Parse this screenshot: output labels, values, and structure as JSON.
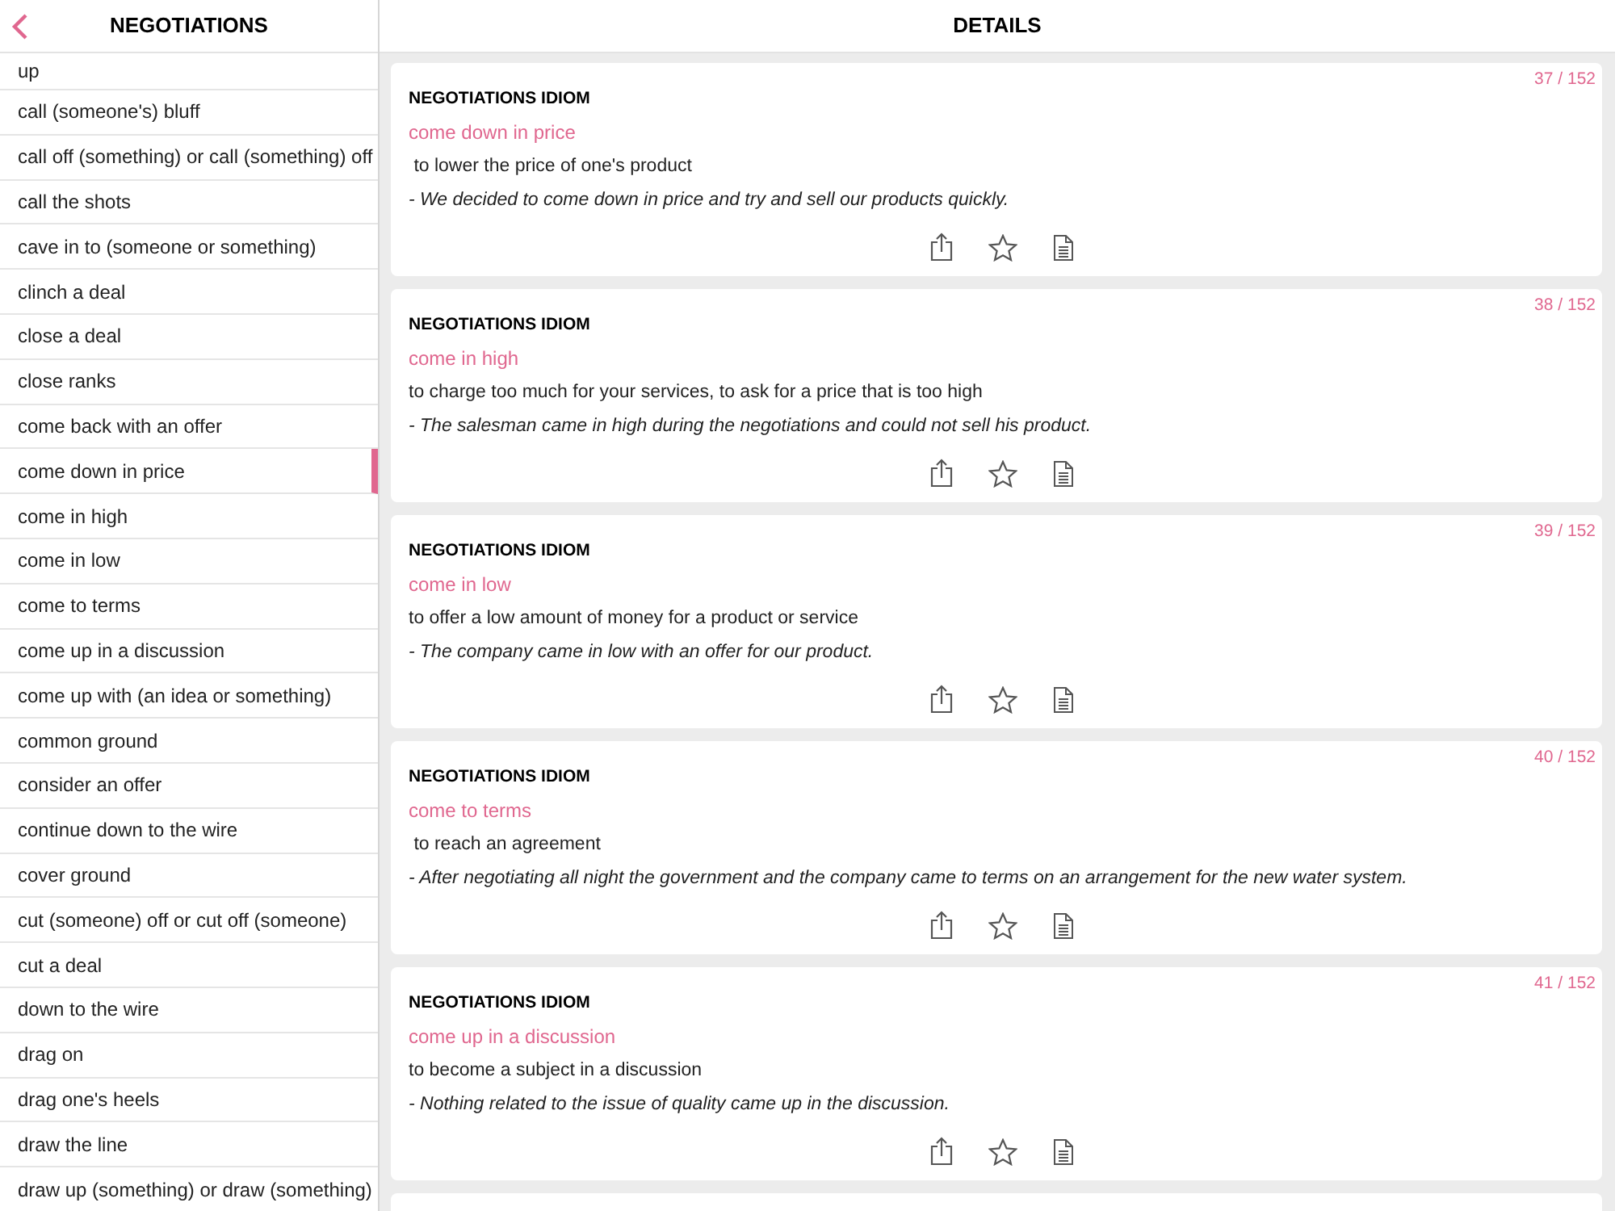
{
  "sidebar": {
    "title": "NEGOTIATIONS",
    "items": [
      {
        "label": "up",
        "selected": false
      },
      {
        "label": "call (someone's) bluff",
        "selected": false
      },
      {
        "label": "call off (something) or call (something) off",
        "selected": false
      },
      {
        "label": "call the shots",
        "selected": false
      },
      {
        "label": "cave in to (someone or something)",
        "selected": false
      },
      {
        "label": "clinch a deal",
        "selected": false
      },
      {
        "label": "close a deal",
        "selected": false
      },
      {
        "label": "close ranks",
        "selected": false
      },
      {
        "label": "come back with an offer",
        "selected": false
      },
      {
        "label": "come down in price",
        "selected": true
      },
      {
        "label": "come in high",
        "selected": false
      },
      {
        "label": "come in low",
        "selected": false
      },
      {
        "label": "come to terms",
        "selected": false
      },
      {
        "label": "come up in a discussion",
        "selected": false
      },
      {
        "label": "come up with (an idea or something)",
        "selected": false
      },
      {
        "label": "common ground",
        "selected": false
      },
      {
        "label": "consider an offer",
        "selected": false
      },
      {
        "label": "continue down to the wire",
        "selected": false
      },
      {
        "label": "cover ground",
        "selected": false
      },
      {
        "label": "cut (someone) off or cut off (someone)",
        "selected": false
      },
      {
        "label": "cut a deal",
        "selected": false
      },
      {
        "label": "down to the wire",
        "selected": false
      },
      {
        "label": "drag on",
        "selected": false
      },
      {
        "label": "drag one's heels",
        "selected": false
      },
      {
        "label": "draw the line",
        "selected": false
      },
      {
        "label": "draw up (something) or draw (something)",
        "selected": false
      }
    ]
  },
  "details": {
    "title": "DETAILS",
    "cards": [
      {
        "counter": "37 / 152",
        "category": "NEGOTIATIONS IDIOM",
        "term": "come down in price",
        "definition": " to lower the price of one's product",
        "example": "- We decided to come down in price and try and sell our products quickly."
      },
      {
        "counter": "38 / 152",
        "category": "NEGOTIATIONS IDIOM",
        "term": "come in high",
        "definition": "to charge too much for your services, to ask for a price that is too high",
        "example": "- The salesman came in high during the negotiations and could not sell his product."
      },
      {
        "counter": "39 / 152",
        "category": "NEGOTIATIONS IDIOM",
        "term": "come in low",
        "definition": "to offer a low amount of money for a product or service",
        "example": "- The company came in low with an offer for our product."
      },
      {
        "counter": "40 / 152",
        "category": "NEGOTIATIONS IDIOM",
        "term": "come to terms",
        "definition": " to reach an agreement",
        "example": "- After negotiating all night the government and the company came to terms on an arrangement for the new water system."
      },
      {
        "counter": "41 / 152",
        "category": "NEGOTIATIONS IDIOM",
        "term": "come up in a discussion",
        "definition": "to become a subject in a discussion",
        "example": "- Nothing related to the issue of quality came up in the discussion."
      }
    ]
  }
}
